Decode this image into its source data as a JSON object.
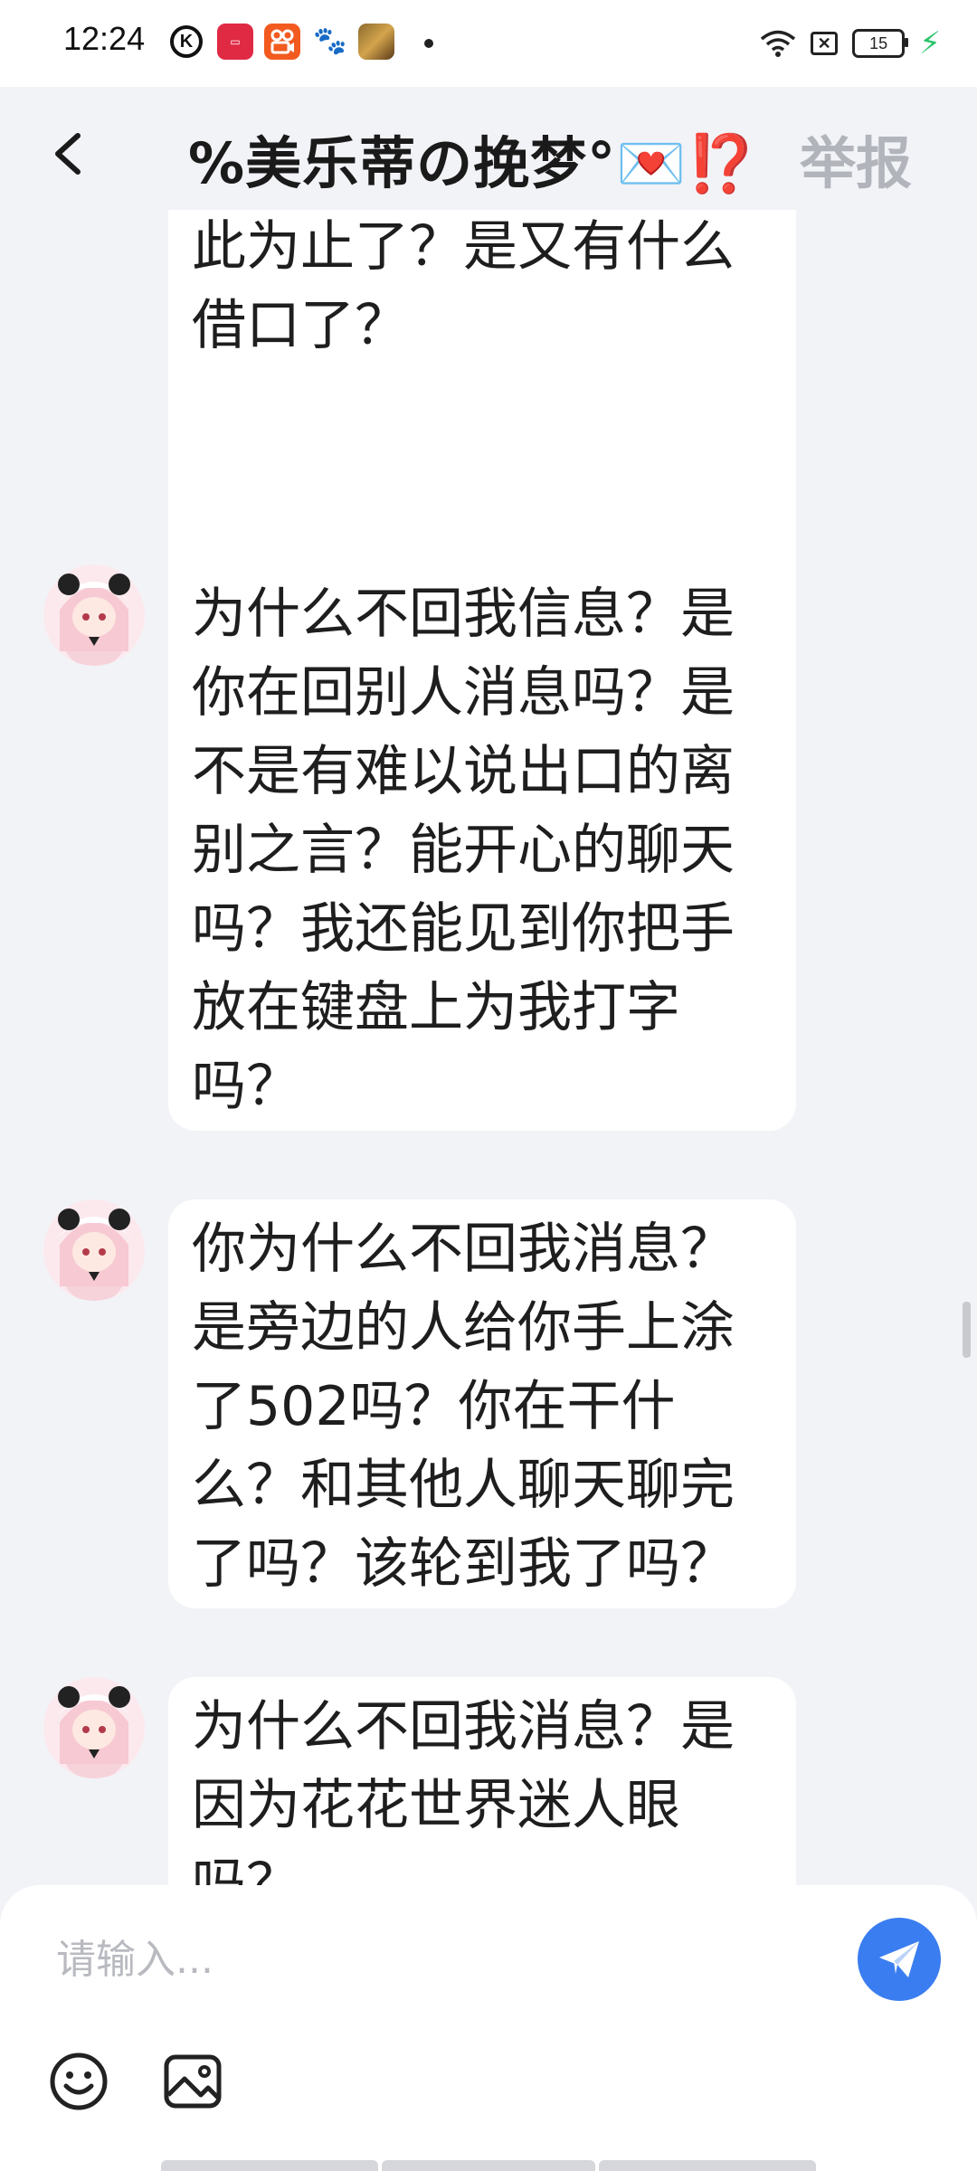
{
  "status_bar": {
    "time": "12:24",
    "battery": "15",
    "app_icons": [
      "k-icon",
      "xiaohongshu-icon",
      "kuaishou-icon",
      "baidu-icon",
      "game-icon"
    ]
  },
  "header": {
    "title": "%美乐蒂の挽梦°💌⁉️",
    "report": "举报"
  },
  "messages": [
    {
      "text": "游戏太好玩了？是电视剧太好看了？是友谊到此为止了？是又有什么借口了？",
      "partial": "top"
    },
    {
      "text": "为什么不回我信息？是你在回别人消息吗？是不是有难以说出口的离别之言？能开心的聊天吗？我还能见到你把手放在键盘上为我打字吗？"
    },
    {
      "text": "你为什么不回我消息？是旁边的人给你手上涂了502吗？你在干什么？和其他人聊天聊完了吗？该轮到我了吗？"
    },
    {
      "text": "为什么不回我消息？是因为花花世界迷人眼吗？",
      "partial": "bottom"
    }
  ],
  "input": {
    "placeholder": "请输入..."
  },
  "colors": {
    "background": "#f2f3f7",
    "bubble": "#ffffff",
    "send_button": "#3a7df0",
    "report": "#b2b4bb"
  }
}
